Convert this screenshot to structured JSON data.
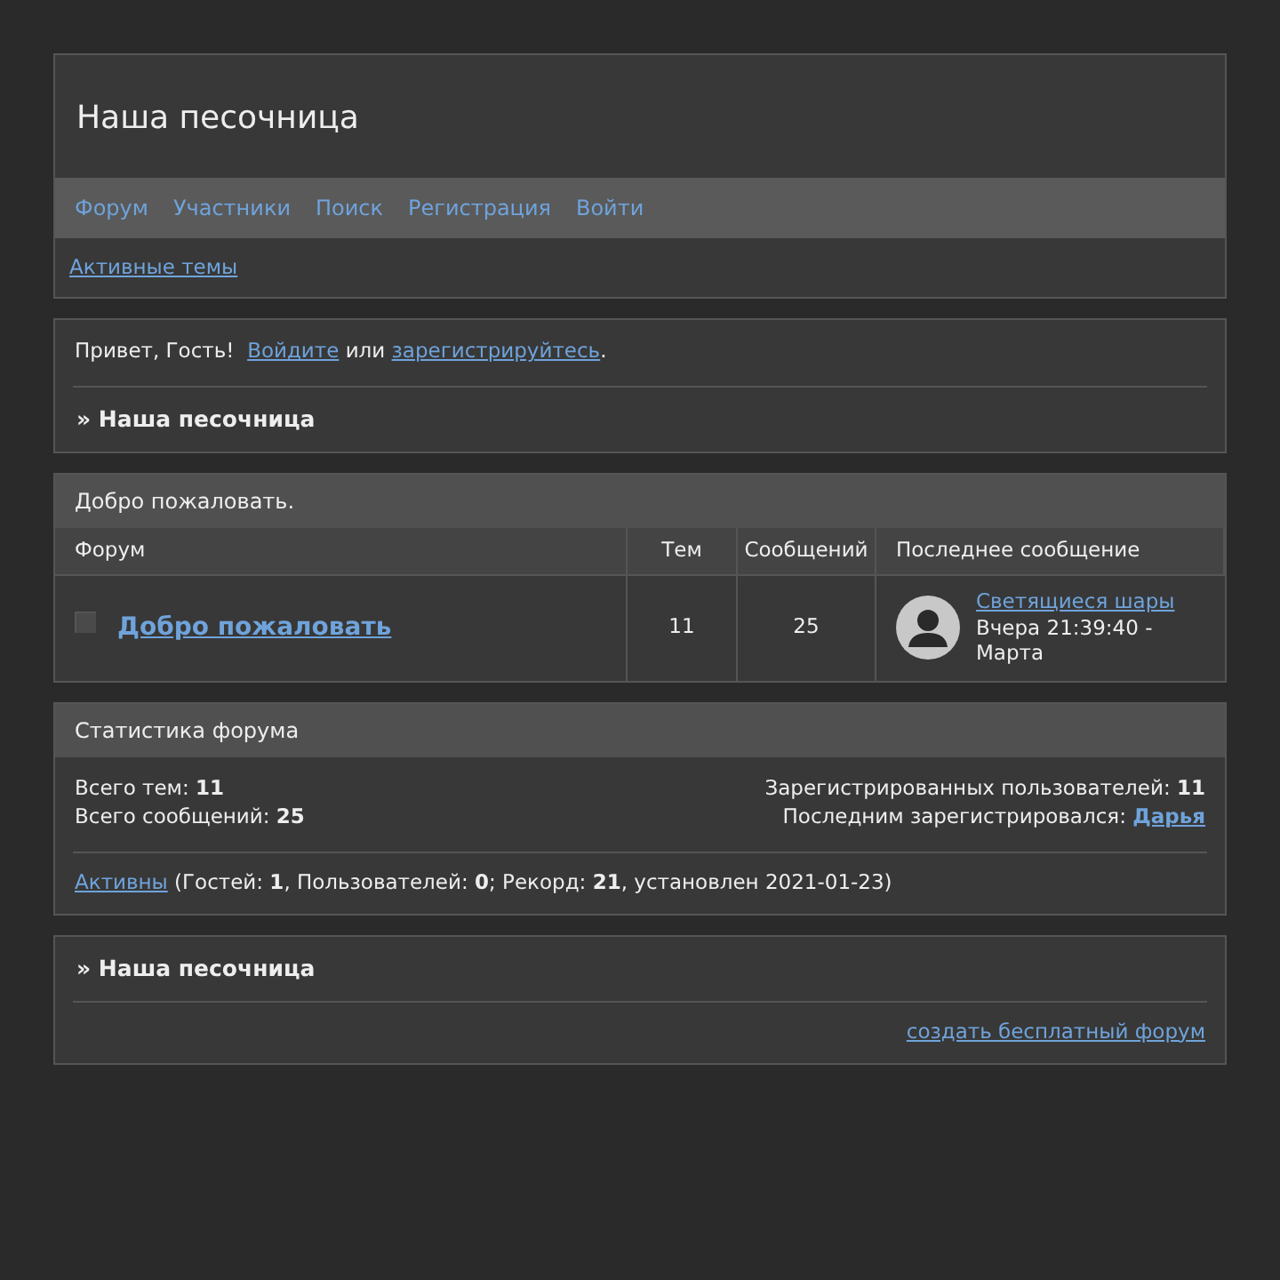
{
  "header": {
    "title": "Наша песочница"
  },
  "nav": [
    "Форум",
    "Участники",
    "Поиск",
    "Регистрация",
    "Войти"
  ],
  "subnav_link": "Активные темы",
  "welcome": [
    {
      "kind": "text",
      "text": "Привет, Гость!  "
    },
    {
      "kind": "link",
      "text": "Войдите"
    },
    {
      "kind": "text",
      "text": " или "
    },
    {
      "kind": "link",
      "text": "зарегистрируйтесь"
    },
    {
      "kind": "text",
      "text": "."
    }
  ],
  "breadcrumb": "» Наша песочница",
  "forum_section": {
    "title": "Добро пожаловать.",
    "columns": [
      "Форум",
      "Тем",
      "Сообщений",
      "Последнее сообщение"
    ],
    "rows": [
      {
        "title": "Добро пожаловать",
        "topics": "11",
        "posts": "25",
        "last_post": {
          "title": "Светящиеся шары",
          "time": "Вчера 21:39:40 - Марта"
        }
      }
    ]
  },
  "stats": {
    "title": "Статистика форума",
    "left": [
      [
        {
          "kind": "text",
          "text": "Всего тем: **11**"
        }
      ],
      [
        {
          "kind": "text",
          "text": "Всего сообщений: **25**"
        }
      ]
    ],
    "right": [
      [
        {
          "kind": "text",
          "text": "Зарегистрированных пользователей: **11**"
        }
      ],
      [
        {
          "kind": "text",
          "text": "Последним зарегистрировался: "
        },
        {
          "kind": "bold-link",
          "text": "Дарья"
        }
      ]
    ],
    "online": [
      {
        "kind": "link",
        "text": "Активны"
      },
      {
        "kind": "text",
        "text": " (Гостей: **1**, Пользователей: **0**; Рекорд: **21**, установлен 2021-01-23)"
      }
    ]
  },
  "footer": {
    "breadcrumb": "» Наша песочница",
    "link": "создать бесплатный форум"
  }
}
